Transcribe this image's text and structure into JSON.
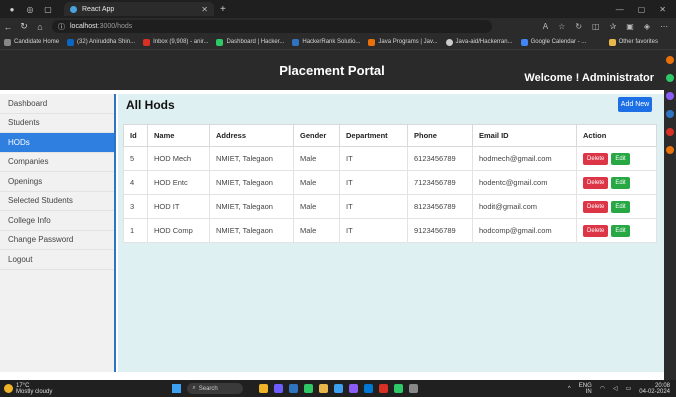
{
  "browser": {
    "tab_title": "React App",
    "url_host": "localhost",
    "url_path": ":3000/hods",
    "bookmarks": [
      {
        "label": "Candidate Home",
        "color": "#888888"
      },
      {
        "label": "(32) Aniruddha Shin...",
        "color": "#0a66c2"
      },
      {
        "label": "Inbox (9,908) - anir...",
        "color": "#d93025"
      },
      {
        "label": "Dashboard | Hacker...",
        "color": "#2ec866"
      },
      {
        "label": "HackerRank Solutio...",
        "color": "#2f74c0"
      },
      {
        "label": "Java Programs | Jav...",
        "color": "#e8710a"
      },
      {
        "label": "Java-aid/Hackerran...",
        "color": "#cccccc"
      },
      {
        "label": "Google Calendar - ...",
        "color": "#4285f4"
      }
    ],
    "other_bookmarks": "Other favorites"
  },
  "header": {
    "title": "Placement Portal",
    "welcome": "Welcome ! Administrator"
  },
  "sidebar": {
    "items": [
      {
        "label": "Dashboard",
        "active": false
      },
      {
        "label": "Students",
        "active": false
      },
      {
        "label": "HODs",
        "active": true
      },
      {
        "label": "Companies",
        "active": false
      },
      {
        "label": "Openings",
        "active": false
      },
      {
        "label": "Selected Students",
        "active": false
      },
      {
        "label": "College Info",
        "active": false
      },
      {
        "label": "Change Password",
        "active": false
      },
      {
        "label": "Logout",
        "active": false
      }
    ]
  },
  "main": {
    "title": "All Hods",
    "add_button": "Add New",
    "columns": [
      "Id",
      "Name",
      "Address",
      "Gender",
      "Department",
      "Phone",
      "Email ID",
      "Action"
    ],
    "delete_label": "Delete",
    "edit_label": "Edit",
    "rows": [
      {
        "id": "5",
        "name": "HOD Mech",
        "address": "NMIET, Talegaon",
        "gender": "Male",
        "department": "IT",
        "phone": "6123456789",
        "email": "hodmech@gmail.com"
      },
      {
        "id": "4",
        "name": "HOD Entc",
        "address": "NMIET, Talegaon",
        "gender": "Male",
        "department": "IT",
        "phone": "7123456789",
        "email": "hodentc@gmail.com"
      },
      {
        "id": "3",
        "name": "HOD IT",
        "address": "NMIET, Talegaon",
        "gender": "Male",
        "department": "IT",
        "phone": "8123456789",
        "email": "hodit@gmail.com"
      },
      {
        "id": "1",
        "name": "HOD Comp",
        "address": "NMIET, Talegaon",
        "gender": "Male",
        "department": "IT",
        "phone": "9123456789",
        "email": "hodcomp@gmail.com"
      }
    ]
  },
  "taskbar": {
    "temperature": "17°C",
    "weather": "Mostly cloudy",
    "search": "Search",
    "lang_top": "ENG",
    "lang_bottom": "IN",
    "time": "20:08",
    "date": "04-02-2024"
  },
  "colors": {
    "primary": "#2f7fe0",
    "danger": "#dc3545",
    "success": "#28a745",
    "header_bg": "#2a2a2a",
    "main_bg": "#dff0f3"
  }
}
